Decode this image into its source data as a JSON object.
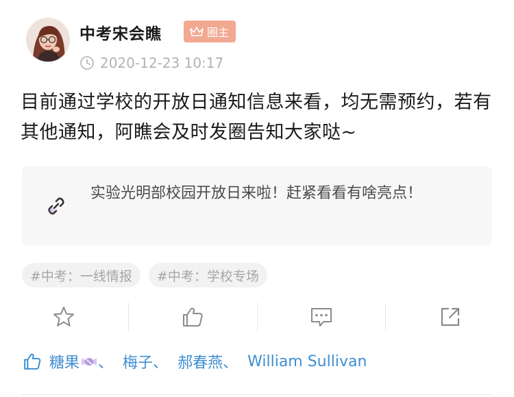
{
  "post": {
    "author": "中考宋会瞧",
    "badge": "圈主",
    "timestamp": "2020-12-23 10:17",
    "content": "目前通过学校的开放日通知信息来看，均无需预约，若有其他通知，阿瞧会及时发圈告知大家哒~"
  },
  "link_card": {
    "title": "实验光明部校园开放日来啦！赶紧看看有啥亮点！",
    "icon": "link-icon"
  },
  "tags": [
    "#中考：一线情报",
    "#中考：学校专场"
  ],
  "actions": [
    {
      "icon": "star-icon"
    },
    {
      "icon": "thumbs-up-icon"
    },
    {
      "icon": "comment-icon"
    },
    {
      "icon": "share-icon"
    }
  ],
  "likes": {
    "icon": "thumbs-up-icon",
    "names": [
      "糖果",
      "梅子",
      "郝春燕",
      "William Sullivan"
    ],
    "separator": "、"
  },
  "colors": {
    "badge": "#f3a892",
    "link": "#3f8ed0",
    "muted": "#b2b2b2",
    "card_bg": "#f7f7f7",
    "tag_bg": "#f2f2f2"
  }
}
